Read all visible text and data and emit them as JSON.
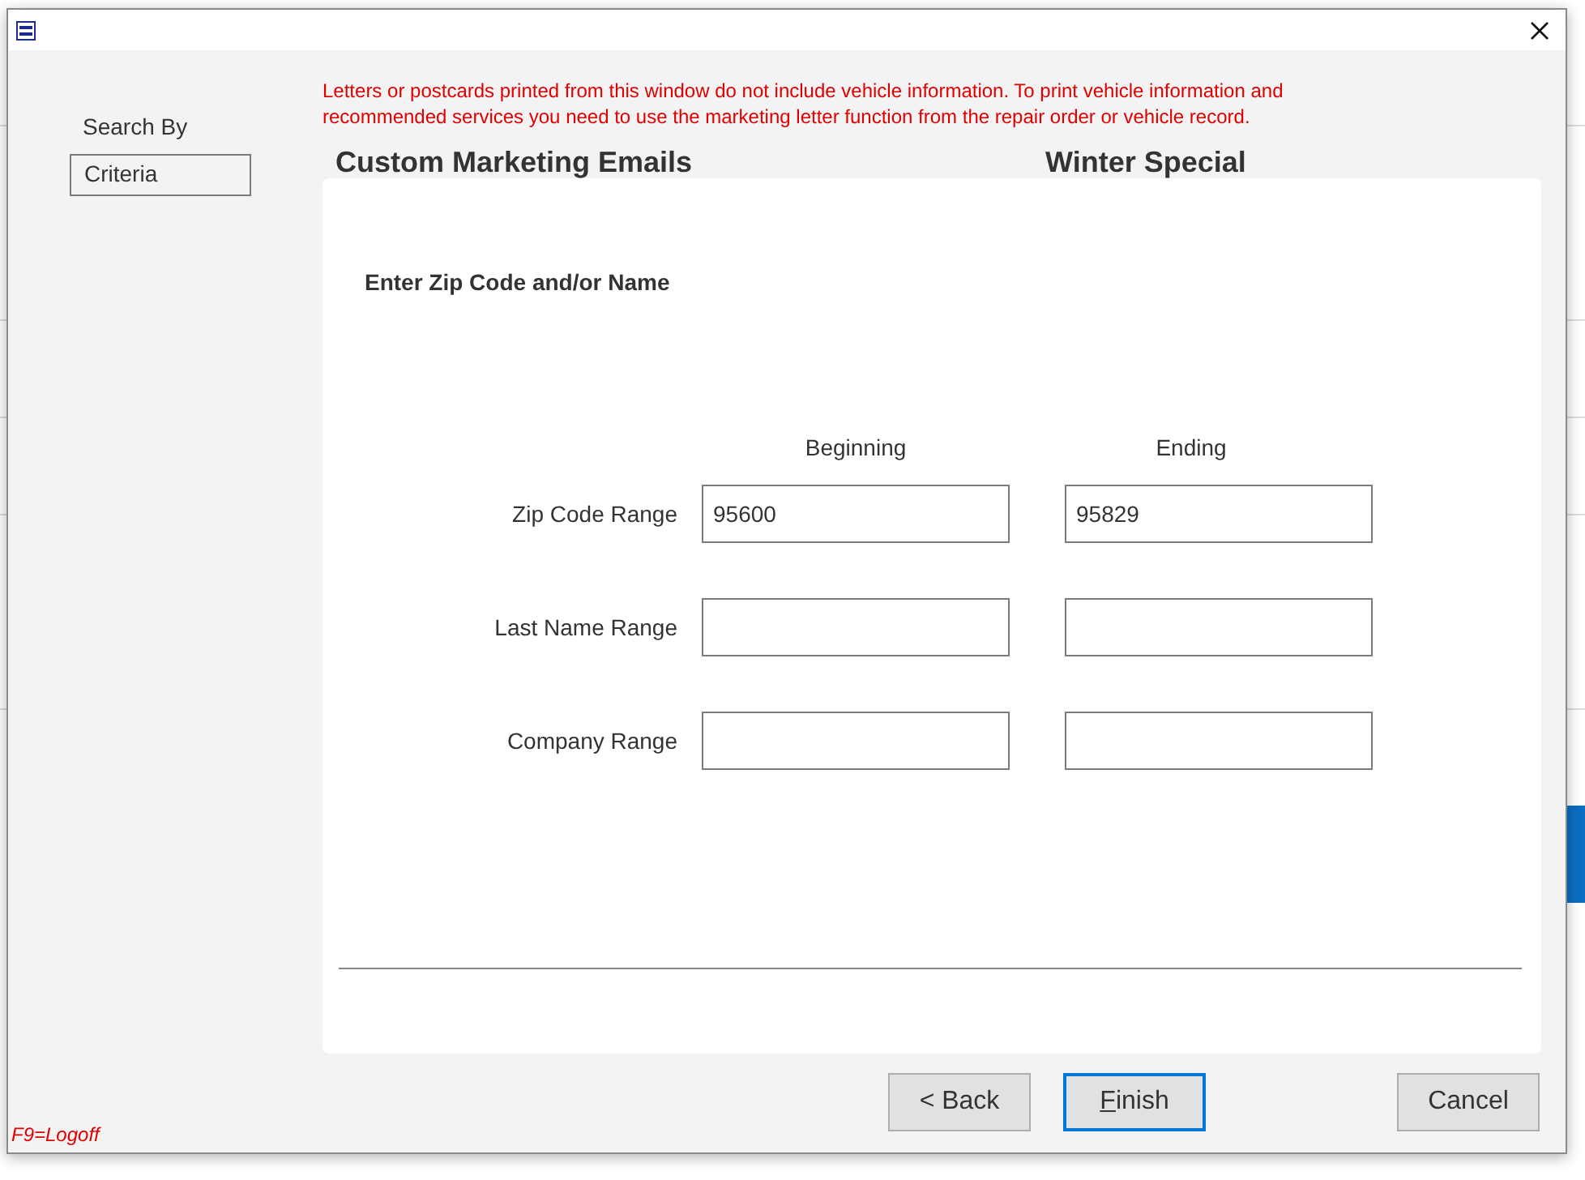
{
  "search_by": {
    "label": "Search By",
    "options": [
      "Criteria"
    ]
  },
  "notice": "Letters or postcards printed from this window do not include vehicle information.  To print vehicle information and recommended services you need to use the marketing letter function from the repair order or vehicle record.",
  "title": "Custom Marketing Emails",
  "campaign": "Winter Special",
  "panel": {
    "heading": "Enter Zip Code and/or Name",
    "columns": [
      "Beginning",
      "Ending"
    ],
    "rows": [
      {
        "label": "Zip Code Range",
        "beginning": "95600",
        "ending": "95829"
      },
      {
        "label": "Last Name Range"
      },
      {
        "label": "Company Range"
      }
    ]
  },
  "buttons": [
    {
      "label": "< Back",
      "kind": "nav",
      "default": false,
      "access_key_underlined": false
    },
    {
      "label": "Finish",
      "kind": "nav",
      "default": true,
      "access_key_underlined": true
    },
    {
      "label": "Cancel",
      "kind": "cancel",
      "default": false,
      "access_key_underlined": false
    }
  ],
  "hotkey_hint": "F9=Logoff"
}
